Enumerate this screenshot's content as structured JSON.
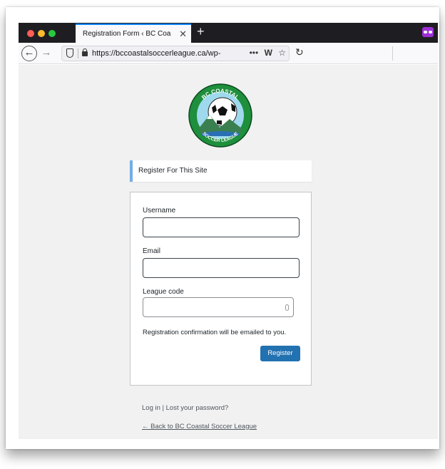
{
  "browser": {
    "tab_title": "Registration Form ‹ BC Coastal Socc",
    "tab_close": "✕",
    "new_tab": "+",
    "url": "https://bccoastalsoccerleague.ca/wp-",
    "url_actions": [
      "•••",
      "W",
      "☆"
    ],
    "icons": [
      "back-arrow-icon",
      "forward-arrow-icon",
      "shield-icon",
      "lock-icon",
      "reload-icon",
      "private-browsing-mask-icon"
    ]
  },
  "logo": {
    "text_top": "BC COASTAL",
    "text_bottom": "SOCCER LEAGUE",
    "colors": {
      "ring": "#1e8f3c",
      "sky": "#9fd9ee",
      "mountain": "#3a7f4f"
    }
  },
  "notice": {
    "text": "Register For This Site",
    "accent": "#72aee6"
  },
  "form": {
    "username_label": "Username",
    "username_value": "",
    "email_label": "Email",
    "email_value": "",
    "league_code_label": "League code",
    "league_code_value": "",
    "confirmation_text": "Registration confirmation will be emailed to you.",
    "register_button": "Register",
    "button_color": "#2271b1"
  },
  "footer": {
    "login_link": "Log in",
    "separator": "|",
    "lost_password_link": "Lost your password?",
    "back_link": "← Back to BC Coastal Soccer League"
  }
}
